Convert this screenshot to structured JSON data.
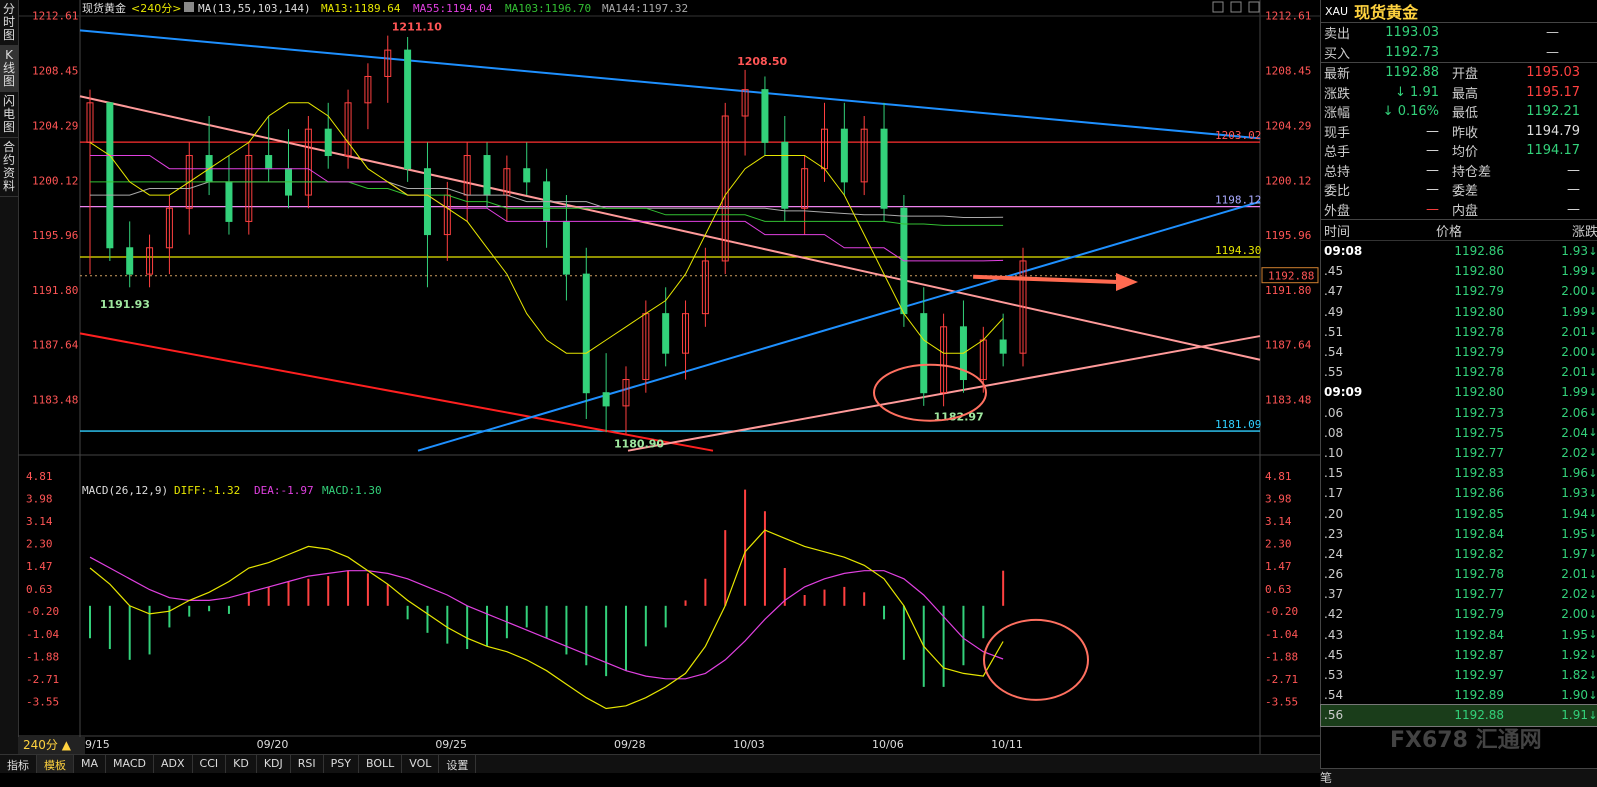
{
  "sidebar": {
    "items": [
      {
        "label": "分时图"
      },
      {
        "label": "K线图"
      },
      {
        "label": "闪电图"
      },
      {
        "label": "合约资料"
      }
    ]
  },
  "chart_header": {
    "symbol": "现货黄金",
    "period_tag": "<240分>",
    "ma_label": "MA(13,55,103,144)",
    "ma13": "MA13:1189.64",
    "ma55": "MA55:1194.04",
    "ma103": "MA103:1196.70",
    "ma144": "MA144:1197.32"
  },
  "macd_header": {
    "label": "MACD(26,12,9)",
    "diff": "DIFF:-1.32",
    "dea": "DEA:-1.97",
    "macd": "MACD:1.30"
  },
  "period_button": "240分 ▲",
  "bottom_tabs": [
    "指标",
    "模板",
    "MA",
    "MACD",
    "ADX",
    "CCI",
    "KD",
    "KDJ",
    "RSI",
    "PSY",
    "BOLL",
    "VOL",
    "设置"
  ],
  "annotations": {
    "high1": "1211.10",
    "high2": "1208.50",
    "low1": "1191.93",
    "low2": "1180.90",
    "low3": "1182.97",
    "level_1203": "1203.02",
    "level_1198": "1198.12",
    "level_1194": "1194.30",
    "level_1181": "1181.09",
    "current": "1192.88"
  },
  "colors": {
    "up": "#ff4040",
    "down": "#33d17a",
    "ma13": "#e6e600",
    "ma55": "#e040e0",
    "ma103": "#33c033",
    "ma144": "#aaaaaa",
    "blue_line": "#1e90ff",
    "pink_line": "#ff9a9a",
    "red_line": "#ff2020",
    "hline_red": "#ff3030",
    "hline_violet": "#ee82ee",
    "hline_yellow": "#e6e600",
    "hline_cyan": "#30d0ff"
  },
  "chart_data": [
    {
      "type": "candlestick",
      "title": "现货黄金<240分>",
      "y_ticks": [
        "1212.61",
        "1208.45",
        "1204.29",
        "1200.12",
        "1195.96",
        "1191.80",
        "1187.64",
        "1183.48"
      ],
      "ylim": [
        1179.5,
        1213.5
      ],
      "x_ticks": [
        "09/15",
        "09/20",
        "09/25",
        "09/28",
        "10/03",
        "10/06",
        "10/11"
      ],
      "candles": [
        {
          "o": 1203,
          "h": 1207,
          "l": 1193,
          "c": 1206
        },
        {
          "o": 1206,
          "h": 1204,
          "l": 1194,
          "c": 1195
        },
        {
          "o": 1195,
          "h": 1197,
          "l": 1192,
          "c": 1193
        },
        {
          "o": 1193,
          "h": 1196,
          "l": 1192,
          "c": 1195
        },
        {
          "o": 1195,
          "h": 1199,
          "l": 1193,
          "c": 1198
        },
        {
          "o": 1198,
          "h": 1203,
          "l": 1196,
          "c": 1202
        },
        {
          "o": 1202,
          "h": 1205,
          "l": 1199,
          "c": 1200
        },
        {
          "o": 1200,
          "h": 1202,
          "l": 1196,
          "c": 1197
        },
        {
          "o": 1197,
          "h": 1203,
          "l": 1196,
          "c": 1202
        },
        {
          "o": 1202,
          "h": 1205,
          "l": 1200,
          "c": 1201
        },
        {
          "o": 1201,
          "h": 1204,
          "l": 1198,
          "c": 1199
        },
        {
          "o": 1199,
          "h": 1205,
          "l": 1198,
          "c": 1204
        },
        {
          "o": 1204,
          "h": 1206,
          "l": 1201,
          "c": 1202
        },
        {
          "o": 1202,
          "h": 1207,
          "l": 1201,
          "c": 1206
        },
        {
          "o": 1206,
          "h": 1209,
          "l": 1204,
          "c": 1208
        },
        {
          "o": 1208,
          "h": 1211.1,
          "l": 1206,
          "c": 1210
        },
        {
          "o": 1210,
          "h": 1211,
          "l": 1200,
          "c": 1201
        },
        {
          "o": 1201,
          "h": 1203,
          "l": 1192,
          "c": 1196
        },
        {
          "o": 1196,
          "h": 1200,
          "l": 1194,
          "c": 1199
        },
        {
          "o": 1199,
          "h": 1203,
          "l": 1197,
          "c": 1202
        },
        {
          "o": 1202,
          "h": 1203,
          "l": 1198,
          "c": 1199
        },
        {
          "o": 1199,
          "h": 1202,
          "l": 1197,
          "c": 1201
        },
        {
          "o": 1201,
          "h": 1203,
          "l": 1199,
          "c": 1200
        },
        {
          "o": 1200,
          "h": 1201,
          "l": 1195,
          "c": 1197
        },
        {
          "o": 1197,
          "h": 1199,
          "l": 1191,
          "c": 1193
        },
        {
          "o": 1193,
          "h": 1195,
          "l": 1182,
          "c": 1184
        },
        {
          "o": 1184,
          "h": 1187,
          "l": 1181,
          "c": 1183
        },
        {
          "o": 1183,
          "h": 1186,
          "l": 1180.9,
          "c": 1185
        },
        {
          "o": 1185,
          "h": 1191,
          "l": 1184,
          "c": 1190
        },
        {
          "o": 1190,
          "h": 1192,
          "l": 1186,
          "c": 1187
        },
        {
          "o": 1187,
          "h": 1191,
          "l": 1185,
          "c": 1190
        },
        {
          "o": 1190,
          "h": 1195,
          "l": 1189,
          "c": 1194
        },
        {
          "o": 1194,
          "h": 1206,
          "l": 1193,
          "c": 1205
        },
        {
          "o": 1205,
          "h": 1208.5,
          "l": 1202,
          "c": 1207
        },
        {
          "o": 1207,
          "h": 1208,
          "l": 1202,
          "c": 1203
        },
        {
          "o": 1203,
          "h": 1205,
          "l": 1197,
          "c": 1198
        },
        {
          "o": 1198,
          "h": 1202,
          "l": 1196,
          "c": 1201
        },
        {
          "o": 1201,
          "h": 1206,
          "l": 1200,
          "c": 1204
        },
        {
          "o": 1204,
          "h": 1206,
          "l": 1199,
          "c": 1200
        },
        {
          "o": 1200,
          "h": 1205,
          "l": 1199,
          "c": 1204
        },
        {
          "o": 1204,
          "h": 1206,
          "l": 1197,
          "c": 1198
        },
        {
          "o": 1198,
          "h": 1199,
          "l": 1189,
          "c": 1190
        },
        {
          "o": 1190,
          "h": 1192,
          "l": 1183,
          "c": 1184
        },
        {
          "o": 1184,
          "h": 1190,
          "l": 1182.97,
          "c": 1189
        },
        {
          "o": 1189,
          "h": 1191,
          "l": 1184,
          "c": 1185
        },
        {
          "o": 1185,
          "h": 1189,
          "l": 1184,
          "c": 1188
        },
        {
          "o": 1188,
          "h": 1190,
          "l": 1186,
          "c": 1187
        },
        {
          "o": 1187,
          "h": 1195,
          "l": 1186,
          "c": 1194
        }
      ],
      "ma13": [
        1203,
        1202,
        1200,
        1199,
        1199,
        1200,
        1201,
        1202,
        1203,
        1205,
        1206,
        1206,
        1205,
        1203,
        1201,
        1200,
        1199,
        1199,
        1198,
        1197,
        1195,
        1193,
        1190,
        1188,
        1187,
        1187,
        1188,
        1189,
        1190,
        1191,
        1193,
        1196,
        1199,
        1201,
        1202,
        1202,
        1202,
        1201,
        1199,
        1196,
        1193,
        1190,
        1188,
        1187,
        1187,
        1188,
        1189.64
      ],
      "ma55": [
        1202,
        1202,
        1202,
        1202,
        1201,
        1201,
        1201,
        1201,
        1201,
        1201,
        1201,
        1201,
        1200,
        1200,
        1200,
        1200,
        1199,
        1199,
        1198,
        1198,
        1198,
        1197,
        1197,
        1197,
        1197,
        1197,
        1197,
        1197,
        1197,
        1197,
        1197,
        1197,
        1197,
        1197,
        1196,
        1196,
        1196,
        1196,
        1195,
        1195,
        1195,
        1194,
        1194,
        1194,
        1194,
        1194,
        1194.04
      ],
      "ma103": [
        1200,
        1200,
        1200,
        1200,
        1200,
        1200,
        1200,
        1200,
        1200,
        1200,
        1200,
        1200,
        1200,
        1200,
        1199.5,
        1199.5,
        1199,
        1199,
        1199,
        1198.5,
        1198.5,
        1198,
        1198,
        1198,
        1198,
        1198,
        1198,
        1198,
        1198,
        1197.5,
        1197.5,
        1197.5,
        1197.5,
        1197.5,
        1197,
        1197,
        1197,
        1197,
        1197,
        1197,
        1197,
        1196.8,
        1196.8,
        1196.7,
        1196.7,
        1196.7,
        1196.7
      ],
      "ma144": [
        1199,
        1199,
        1199,
        1199.5,
        1199.5,
        1199.5,
        1200,
        1200,
        1200,
        1200,
        1200,
        1200,
        1200,
        1200,
        1200,
        1200,
        1199.5,
        1199.5,
        1199.5,
        1199,
        1199,
        1199,
        1198.5,
        1198.5,
        1198.5,
        1198.5,
        1198,
        1198,
        1198,
        1198,
        1198,
        1198,
        1198,
        1198,
        1198,
        1197.8,
        1197.8,
        1197.7,
        1197.6,
        1197.5,
        1197.5,
        1197.4,
        1197.4,
        1197.4,
        1197.3,
        1197.3,
        1197.32
      ]
    },
    {
      "type": "bar",
      "title": "MACD(26,12,9)",
      "y_ticks": [
        "4.81",
        "3.98",
        "3.14",
        "2.30",
        "1.47",
        "0.63",
        "-0.20",
        "-1.04",
        "-1.88",
        "-2.71",
        "-3.55"
      ],
      "ylim": [
        -4.3,
        5.1
      ],
      "macd": [
        -1.2,
        -1.6,
        -2.0,
        -1.8,
        -0.8,
        -0.4,
        -0.2,
        -0.3,
        0.5,
        0.7,
        0.9,
        1.0,
        1.1,
        1.3,
        1.2,
        0.8,
        -0.5,
        -1.0,
        -1.4,
        -1.6,
        -1.5,
        -1.2,
        -0.8,
        -1.2,
        -1.8,
        -2.2,
        -2.6,
        -2.4,
        -1.5,
        -0.8,
        0.2,
        1.0,
        2.8,
        4.3,
        3.5,
        1.4,
        0.4,
        0.6,
        0.7,
        0.5,
        -0.5,
        -2.0,
        -3.0,
        -3.0,
        -2.2,
        -1.2,
        1.3
      ],
      "diff": [
        1.4,
        0.8,
        0.0,
        -0.3,
        -0.2,
        0.2,
        0.5,
        0.9,
        1.4,
        1.6,
        1.9,
        2.2,
        2.1,
        1.8,
        1.3,
        0.8,
        0.2,
        -0.3,
        -0.8,
        -1.2,
        -1.5,
        -1.7,
        -2.0,
        -2.4,
        -2.9,
        -3.4,
        -3.8,
        -3.7,
        -3.4,
        -3.0,
        -2.5,
        -1.5,
        0.0,
        2.0,
        2.8,
        2.5,
        2.2,
        2.0,
        1.8,
        1.5,
        1.0,
        0.0,
        -1.5,
        -2.3,
        -2.5,
        -2.6,
        -1.32
      ],
      "dea": [
        1.8,
        1.4,
        1.0,
        0.6,
        0.3,
        0.2,
        0.2,
        0.3,
        0.5,
        0.7,
        0.9,
        1.1,
        1.2,
        1.3,
        1.3,
        1.2,
        1.0,
        0.7,
        0.4,
        0.0,
        -0.3,
        -0.6,
        -0.9,
        -1.2,
        -1.5,
        -1.8,
        -2.1,
        -2.4,
        -2.6,
        -2.7,
        -2.7,
        -2.5,
        -2.0,
        -1.3,
        -0.5,
        0.2,
        0.7,
        1.0,
        1.2,
        1.3,
        1.3,
        1.0,
        0.4,
        -0.4,
        -1.2,
        -1.7,
        -1.97
      ]
    }
  ],
  "quote": {
    "code": "XAU",
    "name": "现货黄金",
    "rows_top": [
      {
        "label": "卖出",
        "value": "1193.03",
        "vcls": "g",
        "dash": "—"
      },
      {
        "label": "买入",
        "value": "1192.73",
        "vcls": "g",
        "dash": "—"
      }
    ],
    "rows_grid": [
      {
        "l1": "最新",
        "v1": "1192.88",
        "c1": "g",
        "l2": "开盘",
        "v2": "1195.03",
        "c2": "r"
      },
      {
        "l1": "涨跌",
        "v1": "↓ 1.91",
        "c1": "g",
        "l2": "最高",
        "v2": "1195.17",
        "c2": "r"
      },
      {
        "l1": "涨幅",
        "v1": "↓ 0.16%",
        "c1": "g",
        "l2": "最低",
        "v2": "1192.21",
        "c2": "g"
      },
      {
        "l1": "现手",
        "v1": "—",
        "c1": "w",
        "l2": "昨收",
        "v2": "1194.79",
        "c2": "w"
      },
      {
        "l1": "总手",
        "v1": "—",
        "c1": "w",
        "l2": "均价",
        "v2": "1194.17",
        "c2": "g"
      },
      {
        "l1": "总持",
        "v1": "—",
        "c1": "w",
        "l2": "持仓差",
        "v2": "—",
        "c2": "w"
      },
      {
        "l1": "委比",
        "v1": "—",
        "c1": "w",
        "l2": "委差",
        "v2": "—",
        "c2": "w"
      },
      {
        "l1": "外盘",
        "v1": "—",
        "c1": "r",
        "l2": "内盘",
        "v2": "—",
        "c2": "w"
      }
    ],
    "ticks_header": {
      "time": "时间",
      "price": "价格",
      "change": "涨跌"
    },
    "ticks": [
      {
        "t": "09:08",
        "p": "1192.86",
        "c": "1.93"
      },
      {
        "t": ".45",
        "p": "1192.80",
        "c": "1.99"
      },
      {
        "t": ".47",
        "p": "1192.79",
        "c": "2.00"
      },
      {
        "t": ".49",
        "p": "1192.80",
        "c": "1.99"
      },
      {
        "t": ".51",
        "p": "1192.78",
        "c": "2.01"
      },
      {
        "t": ".54",
        "p": "1192.79",
        "c": "2.00"
      },
      {
        "t": ".55",
        "p": "1192.78",
        "c": "2.01"
      },
      {
        "t": "09:09",
        "p": "1192.80",
        "c": "1.99"
      },
      {
        "t": ".06",
        "p": "1192.73",
        "c": "2.06"
      },
      {
        "t": ".08",
        "p": "1192.75",
        "c": "2.04"
      },
      {
        "t": ".10",
        "p": "1192.77",
        "c": "2.02"
      },
      {
        "t": ".15",
        "p": "1192.83",
        "c": "1.96"
      },
      {
        "t": ".17",
        "p": "1192.86",
        "c": "1.93"
      },
      {
        "t": ".20",
        "p": "1192.85",
        "c": "1.94"
      },
      {
        "t": ".23",
        "p": "1192.84",
        "c": "1.95"
      },
      {
        "t": ".24",
        "p": "1192.82",
        "c": "1.97"
      },
      {
        "t": ".26",
        "p": "1192.78",
        "c": "2.01"
      },
      {
        "t": ".37",
        "p": "1192.77",
        "c": "2.02"
      },
      {
        "t": ".42",
        "p": "1192.79",
        "c": "2.00"
      },
      {
        "t": ".43",
        "p": "1192.84",
        "c": "1.95"
      },
      {
        "t": ".45",
        "p": "1192.87",
        "c": "1.92"
      },
      {
        "t": ".53",
        "p": "1192.97",
        "c": "1.82"
      },
      {
        "t": ".54",
        "p": "1192.89",
        "c": "1.90"
      },
      {
        "t": ".56",
        "p": "1192.88",
        "c": "1.91"
      }
    ],
    "footer": "笔",
    "watermark": "FX678 汇通网"
  }
}
